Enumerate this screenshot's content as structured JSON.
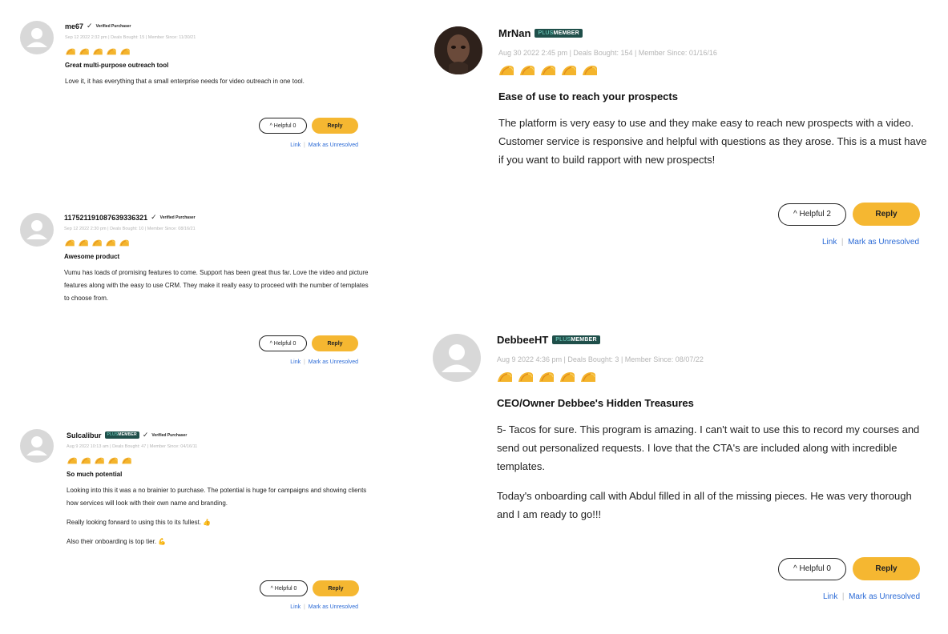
{
  "colors": {
    "reply_button": "#f5b731",
    "link": "#2c6bd6",
    "badge": "#1f4f4a"
  },
  "icons": {
    "avatar": "user-silhouette-icon",
    "taco": "taco-icon",
    "check": "check-icon",
    "chevron": "chevron-up-icon"
  },
  "reviews": [
    {
      "username": "me67",
      "verified": "Verified Purchaser",
      "meta": "Sep 12 2022 2:32 pm | Deals Bought: 15 | Member Since: 11/30/21",
      "rating": 5,
      "title": "Great multi-purpose outreach tool",
      "paragraphs": [
        "Love it, it has everything that a small enterprise needs for video outreach in one tool."
      ],
      "helpful": "Helpful 0",
      "reply": "Reply",
      "link": "Link",
      "resolve": "Mark as Unresolved"
    },
    {
      "username": "117521191087639336321",
      "verified": "Verified Purchaser",
      "meta": "Sep 12 2022 2:30 pm | Deals Bought: 10 | Member Since: 08/16/21",
      "rating": 5,
      "title": "Awesome product",
      "paragraphs": [
        "Vumu has loads of promising features to come. Support has been great thus far. Love the video and picture features along with the easy to use CRM. They make it really easy to proceed with the number of templates to choose from."
      ],
      "helpful": "Helpful 0",
      "reply": "Reply",
      "link": "Link",
      "resolve": "Mark as Unresolved"
    },
    {
      "username": "Sulcalibur",
      "badge_plus": "PLUS",
      "badge_member": "MEMBER",
      "verified": "Verified Purchaser",
      "meta": "Aug 9 2022 10:13 am | Deals Bought: 47 | Member Since: 04/16/11",
      "rating": 5,
      "title": "So much potential",
      "paragraphs": [
        "Looking into this it was a no brainier to purchase. The potential is huge for campaigns and showing clients how services will look with their own name and branding.",
        "Really looking forward to using this to its fullest. 👍",
        "Also their onboarding is top tier. 💪"
      ],
      "helpful": "Helpful 0",
      "reply": "Reply",
      "link": "Link",
      "resolve": "Mark as Unresolved"
    },
    {
      "username": "MrNan",
      "badge_plus": "PLUS",
      "badge_member": "MEMBER",
      "meta": "Aug 30 2022 2:45 pm | Deals Bought: 154 | Member Since: 01/16/16",
      "rating": 5,
      "title": "Ease of use to reach your prospects",
      "paragraphs": [
        "The platform is very easy to use and they make easy to reach new prospects with a video. Customer service is responsive and helpful with questions as they arose. This is a must have if you want to build rapport with new prospects!"
      ],
      "helpful": "Helpful 2",
      "reply": "Reply",
      "link": "Link",
      "resolve": "Mark as Unresolved"
    },
    {
      "username": "DebbeeHT",
      "badge_plus": "PLUS",
      "badge_member": "MEMBER",
      "meta": "Aug 9 2022 4:36 pm | Deals Bought: 3 | Member Since: 08/07/22",
      "rating": 5,
      "title": "CEO/Owner Debbee's Hidden Treasures",
      "paragraphs": [
        "5- Tacos for sure. This program is amazing. I can't wait to use this to record my courses and send out personalized requests. I love that the CTA's are included along with incredible templates.",
        "Today's onboarding call with Abdul filled in all of the missing pieces. He was very thorough and I am ready to go!!!"
      ],
      "helpful": "Helpful 0",
      "reply": "Reply",
      "link": "Link",
      "resolve": "Mark as Unresolved"
    }
  ]
}
